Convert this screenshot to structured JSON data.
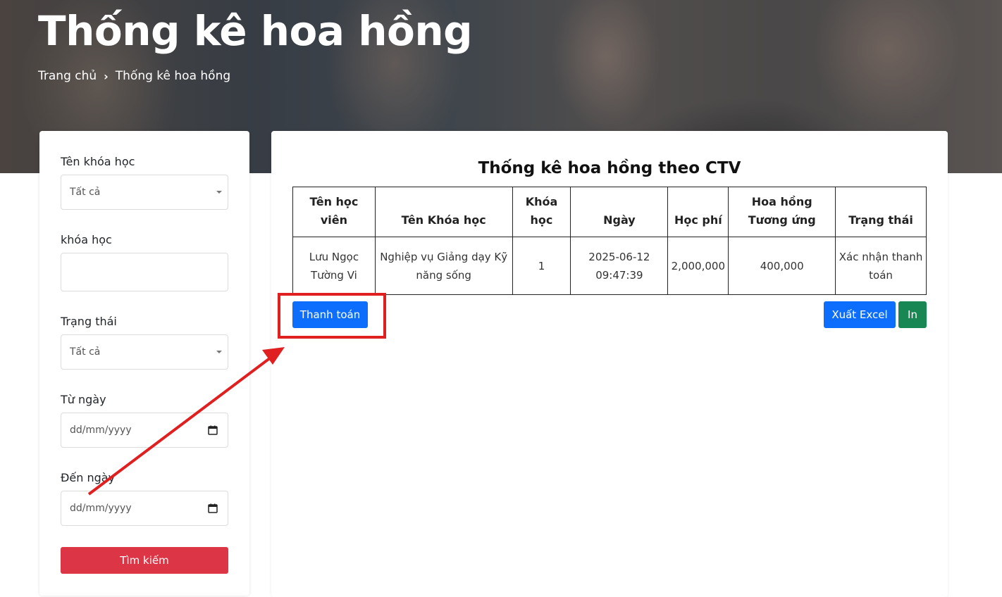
{
  "hero": {
    "title": "Thống kê hoa hồng",
    "breadcrumb": {
      "home": "Trang chủ",
      "separator": "›",
      "current": "Thống kê hoa hồng"
    }
  },
  "filters": {
    "course_name": {
      "label": "Tên khóa học",
      "value": "Tất cả"
    },
    "cohort": {
      "label": "khóa học",
      "value": ""
    },
    "status": {
      "label": "Trạng thái",
      "value": "Tất cả"
    },
    "from_date": {
      "label": "Từ ngày",
      "placeholder": "dd/mm/yyyy"
    },
    "to_date": {
      "label": "Đến ngày",
      "placeholder": "dd/mm/yyyy"
    },
    "search_label": "Tìm kiếm"
  },
  "report": {
    "title": "Thống kê hoa hồng theo CTV",
    "columns": [
      "Tên học viên",
      "Tên Khóa học",
      "Khóa học",
      "Ngày",
      "Học phí",
      "Hoa hồng Tương ứng",
      "Trạng thái"
    ],
    "rows": [
      {
        "student": "Lưu Ngọc Tường Vi",
        "course": "Nghiệp vụ Giảng dạy Kỹ năng sống",
        "cohort": "1",
        "date": "2025-06-12 09:47:39",
        "fee": "2,000,000",
        "commission": "400,000",
        "status": "Xác nhận thanh toán"
      }
    ]
  },
  "actions": {
    "pay_label": "Thanh toán",
    "excel_label": "Xuất Excel",
    "print_label": "In"
  },
  "colors": {
    "primary": "#0d6efd",
    "danger": "#dc3545",
    "success": "#198754",
    "warning_text": "#f0b429",
    "annotation": "#e02020"
  },
  "icons": {
    "select_caret": "caret-down-icon",
    "date_picker": "calendar-icon",
    "breadcrumb_separator": "chevron-right-icon"
  }
}
